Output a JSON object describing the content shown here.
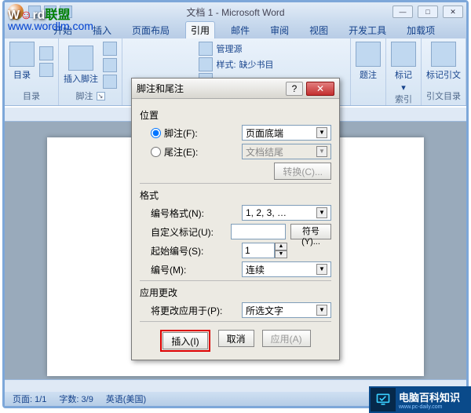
{
  "overlay": {
    "brand_a": "W",
    "brand_b": "rd",
    "brand_c": "联盟",
    "url": "www.wordlm.com"
  },
  "titlebar": {
    "title": "文档 1 - Microsoft Word"
  },
  "tabs": {
    "t1": "开始",
    "t2": "插入",
    "t3": "页面布局",
    "t4": "引用",
    "t5": "邮件",
    "t6": "审阅",
    "t7": "视图",
    "t8": "开发工具",
    "t9": "加载项"
  },
  "ribbon": {
    "toc": "目录",
    "footnote": "插入脚注",
    "footnote_group": "脚注",
    "manage_source": "管理源",
    "style_label": "样式:",
    "style_value": "缺少书目",
    "caption": "题注",
    "mark": "标记",
    "mark_citation": "标记引文",
    "index": "索引",
    "toa": "引文目录"
  },
  "dialog": {
    "title": "脚注和尾注",
    "loc": "位置",
    "footnote_rb": "脚注(F):",
    "footnote_val": "页面底端",
    "endnote_rb": "尾注(E):",
    "endnote_val": "文档结尾",
    "convert": "转换(C)...",
    "format": "格式",
    "numfmt": "编号格式(N):",
    "numfmt_val": "1, 2, 3, …",
    "custom": "自定义标记(U):",
    "symbol": "符号(Y)...",
    "start": "起始编号(S):",
    "start_val": "1",
    "numbering": "编号(M):",
    "numbering_val": "连续",
    "apply": "应用更改",
    "applyto": "将更改应用于(P):",
    "applyto_val": "所选文字",
    "insert_btn": "插入(I)",
    "cancel_btn": "取消",
    "apply_btn": "应用(A)"
  },
  "page": {
    "url": "www.wordlm.com"
  },
  "status": {
    "page": "页面: 1/1",
    "words": "字数: 3/9",
    "lang": "英语(美国)"
  },
  "badge": {
    "cn": "电脑百科知识",
    "en": "www.pc-daily.com"
  }
}
